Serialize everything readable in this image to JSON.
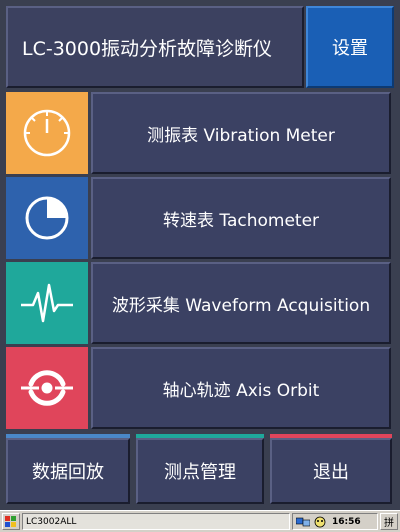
{
  "app": {
    "title": "LC-3000振动分析故障诊断仪",
    "settings_label": "设置"
  },
  "menu": [
    {
      "label": "测振表 Vibration Meter",
      "icon": "gauge-icon",
      "color": "#f4a94a"
    },
    {
      "label": "转速表 Tachometer",
      "icon": "pie-chart-icon",
      "color": "#2e62ad"
    },
    {
      "label": "波形采集 Waveform Acquisition",
      "icon": "waveform-icon",
      "color": "#1fa89b"
    },
    {
      "label": "轴心轨迹 Axis Orbit",
      "icon": "orbit-icon",
      "color": "#e0455b"
    }
  ],
  "bottom": [
    {
      "label": "数据回放",
      "accent": "#4a88c8"
    },
    {
      "label": "测点管理",
      "accent": "#1fa89b"
    },
    {
      "label": "退出",
      "accent": "#e0455b"
    }
  ],
  "taskbar": {
    "task_label": "LC3002ALL",
    "clock": "16:56",
    "ime": "拼",
    "start_icon": "windows-flag-icon",
    "tray_icons": [
      "network-icon",
      "input-method-icon"
    ]
  }
}
